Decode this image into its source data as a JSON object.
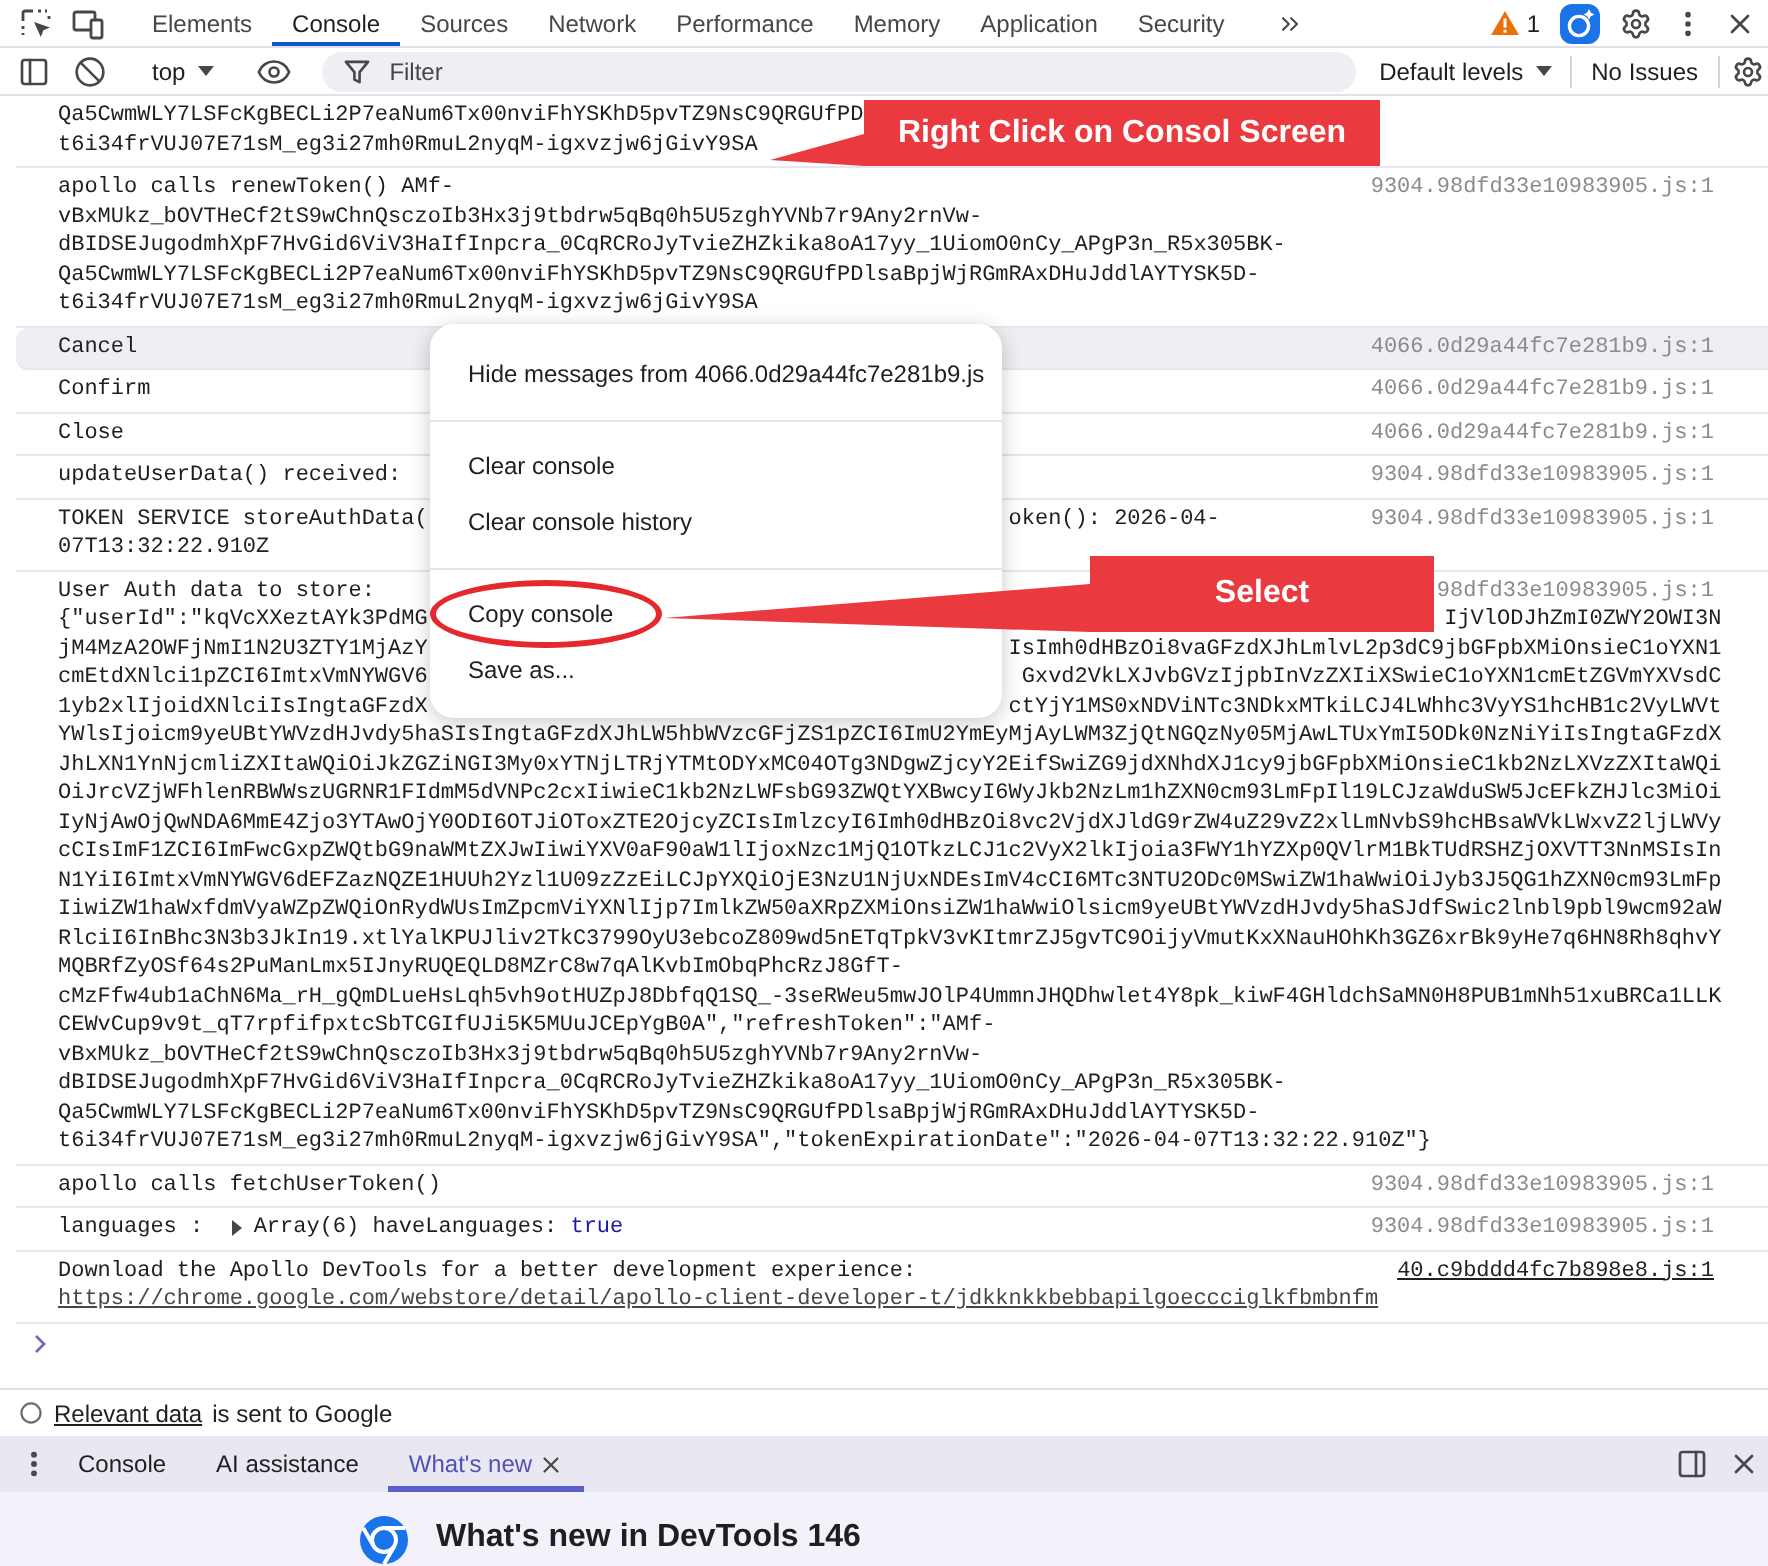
{
  "main_tabs": [
    {
      "label": "Elements",
      "selected": false
    },
    {
      "label": "Console",
      "selected": true
    },
    {
      "label": "Sources",
      "selected": false
    },
    {
      "label": "Network",
      "selected": false
    },
    {
      "label": "Performance",
      "selected": false
    },
    {
      "label": "Memory",
      "selected": false
    },
    {
      "label": "Application",
      "selected": false
    },
    {
      "label": "Security",
      "selected": false
    }
  ],
  "issues_counter": {
    "count": "1"
  },
  "toolbar": {
    "context": "top",
    "filter": {
      "placeholder": "Filter"
    },
    "levels": "Default levels",
    "issues": "No Issues"
  },
  "messages": [
    {
      "highlighted": false,
      "body": [
        {
          "kind": "split",
          "left": "Qa5CwmWLY7LSFcKgBECLi2P7eaNum6Tx00nviFhYSKhD5pvTZ9NsC9QRGUfPD"
        },
        {
          "kind": "text",
          "text": "t6i34frVUJ07E71sM_eg3i27mh0RmuL2nyqM-igxvzjw6jGivY9SA"
        }
      ]
    },
    {
      "highlighted": false,
      "lines": [
        {
          "kind": "text",
          "text": "apollo calls renewToken() AMf-"
        }
      ],
      "source": {
        "text": "9304.98dfd33e10983905.js:1",
        "dimmed": true
      },
      "body": [
        {
          "kind": "text",
          "text": "vBxMUkz_bOVTHeCf2tS9wChnQsczoIb3Hx3j9tbdrw5qBq0h5U5zghYVNb7r9Any2rnVw-"
        },
        {
          "kind": "text",
          "text": "dBIDSEJugodmhXpF7HvGid6ViV3HaIfInpcra_0CqRCRoJyTvieZHZkika8oA17yy_1UiomO0nCy_APgP3n_R5x305BK-"
        },
        {
          "kind": "text",
          "text": "Qa5CwmWLY7LSFcKgBECLi2P7eaNum6Tx00nviFhYSKhD5pvTZ9NsC9QRGUfPDlsaBpjWjRGmRAxDHuJddlAYTYSK5D-"
        },
        {
          "kind": "text",
          "text": "t6i34frVUJ07E71sM_eg3i27mh0RmuL2nyqM-igxvzjw6jGivY9SA"
        }
      ]
    },
    {
      "highlighted": true,
      "lines": [
        {
          "kind": "text",
          "text": "Cancel"
        }
      ],
      "source": {
        "text": "4066.0d29a44fc7e281b9.js:1",
        "dimmed": true
      }
    },
    {
      "highlighted": false,
      "lines": [
        {
          "kind": "text",
          "text": "Confirm"
        }
      ],
      "source": {
        "text": "4066.0d29a44fc7e281b9.js:1",
        "dimmed": true
      }
    },
    {
      "highlighted": false,
      "lines": [
        {
          "kind": "text",
          "text": "Close"
        }
      ],
      "source": {
        "text": "4066.0d29a44fc7e281b9.js:1",
        "dimmed": true
      }
    },
    {
      "highlighted": false,
      "lines": [
        {
          "kind": "text",
          "text": "updateUserData() received:"
        }
      ],
      "source": {
        "text": "9304.98dfd33e10983905.js:1",
        "dimmed": true
      }
    },
    {
      "highlighted": false,
      "lines": [
        {
          "kind": "split",
          "left": "TOKEN SERVICE storeAuthData(",
          "right": "oken(): 2026-04-"
        },
        {
          "kind": "text",
          "text": "07T13:32:22.910Z"
        }
      ],
      "source": {
        "text": "9304.98dfd33e10983905.js:1",
        "dimmed": true
      }
    },
    {
      "highlighted": false,
      "lines": [
        {
          "kind": "text",
          "text": "User Auth data to store:"
        }
      ],
      "source": {
        "text": "98dfd33e10983905.js:1",
        "dimmed": true
      },
      "body": [
        {
          "kind": "split",
          "left": "{\"userId\":\"kqVcXXeztAYk3PdMG",
          "right": "IjVlODJhZmI0ZWY2OWI3N"
        },
        {
          "kind": "split",
          "left": "jM4MzA2OWFjNmI1N2U3ZTY1MjAzY",
          "right": "IsImh0dHBzOi8vaGFzdXJhLmlvL2p3dC9jbGFpbXMiOnsieC1oYXN1"
        },
        {
          "kind": "split",
          "left": "cmEtdXNlci1pZCI6ImtxVmNYWGV6",
          "right": "Gxvd2VkLXJvbGVzIjpbInVzZXIiXSwieC1oYXN1cmEtZGVmYXVsdC"
        },
        {
          "kind": "split",
          "left": "1yb2xlIjoidXNlciIsIngtaGFzdX",
          "right": "ctYjY1MS0xNDViNTc3NDkxMTkiLCJ4LWhhc3VyYS1hcHB1c2VyLWVt"
        },
        {
          "kind": "text",
          "text": "YWlsIjoicm9yeUBtYWVzdHJvdy5haSIsIngtaGFzdXJhLW5hbWVzcGFjZS1pZCI6ImU2YmEyMjAyLWM3ZjQtNGQzNy05MjAwLTUxYmI5ODk0NzNiYiIsIngtaGFzdX"
        },
        {
          "kind": "text",
          "text": "JhLXN1YnNjcmliZXItaWQiOiJkZGZiNGI3My0xYTNjLTRjYTMtODYxMC04OTg3NDgwZjcyY2EifSwiZG9jdXNhdXJ1cy9jbGFpbXMiOnsieC1kb2NzLXVzZXItaWQi"
        },
        {
          "kind": "text",
          "text": "OiJrcVZjWFhlenRBWWszUGRNR1FIdmM5dVNPc2cxIiwieC1kb2NzLWFsbG93ZWQtYXBwcyI6WyJkb2NzLm1hZXN0cm93LmFpIl19LCJzaWduSW5JcEFkZHJlc3MiOi"
        },
        {
          "kind": "text",
          "text": "IyNjAwOjQwNDA6MmE4Zjo3YTAwOjY0ODI6OTJiOToxZTE2OjcyZCIsImlzcyI6Imh0dHBzOi8vc2VjdXJldG9rZW4uZ29vZ2xlLmNvbS9hcHBsaWVkLWxvZ2ljLWVy"
        },
        {
          "kind": "text",
          "text": "cCIsImF1ZCI6ImFwcGxpZWQtbG9naWMtZXJwIiwiYXV0aF90aW1lIjoxNzc1MjQ1OTkzLCJ1c2VyX2lkIjoia3FWY1hYZXp0QVlrM1BkTUdRSHZjOXVTT3NnMSIsIn"
        },
        {
          "kind": "text",
          "text": "N1YiI6ImtxVmNYWGV6dEFZazNQZE1HUUh2Yzl1U09zZzEiLCJpYXQiOjE3NzU1NjUxNDEsImV4cCI6MTc3NTU2ODc0MSwiZW1haWwiOiJyb3J5QG1hZXN0cm93LmFp"
        },
        {
          "kind": "text",
          "text": "IiwiZW1haWxfdmVyaWZpZWQiOnRydWUsImZpcmViYXNlIjp7ImlkZW50aXRpZXMiOnsiZW1haWwiOlsicm9yeUBtYWVzdHJvdy5haSJdfSwic2lnbl9pbl9wcm92aW"
        },
        {
          "kind": "text",
          "text": "RlciI6InBhc3N3b3JkIn19.xtlYalKPUJliv2TkC3799OyU3ebcoZ809wd5nETqTpkV3vKItmrZJ5gvTC9OijyVmutKxXNauHOhKh3GZ6xrBk9yHe7q6HN8Rh8qhvY"
        },
        {
          "kind": "text",
          "text": "MQBRfZyOSf64s2PuManLmx5IJnyRUQEQLD8MZrC8w7qAlKvbImObqPhcRzJ8GfT-"
        },
        {
          "kind": "text",
          "text": "cMzFfw4ub1aChN6Ma_rH_gQmDLueHsLqh5vh9otHUZpJ8DbfqQ1SQ_-3seRWeu5mwJOlP4UmmnJHQDhwlet4Y8pk_kiwF4GHldchSaMN0H8PUB1mNh51xuBRCa1LLK"
        },
        {
          "kind": "text",
          "text": "CEWvCup9v9t_qT7rpfifpxtcSbTCGIfUJi5K5MUuJCEpYgB0A\",\"refreshToken\":\"AMf-"
        },
        {
          "kind": "text",
          "text": "vBxMUkz_bOVTHeCf2tS9wChnQsczoIb3Hx3j9tbdrw5qBq0h5U5zghYVNb7r9Any2rnVw-"
        },
        {
          "kind": "text",
          "text": "dBIDSEJugodmhXpF7HvGid6ViV3HaIfInpcra_0CqRCRoJyTvieZHZkika8oA17yy_1UiomO0nCy_APgP3n_R5x305BK-"
        },
        {
          "kind": "text",
          "text": "Qa5CwmWLY7LSFcKgBECLi2P7eaNum6Tx00nviFhYSKhD5pvTZ9NsC9QRGUfPDlsaBpjWjRGmRAxDHuJddlAYTYSK5D-"
        },
        {
          "kind": "text",
          "text": "t6i34frVUJ07E71sM_eg3i27mh0RmuL2nyqM-igxvzjw6jGivY9SA\",\"tokenExpirationDate\":\"2026-04-07T13:32:22.910Z\"}"
        }
      ]
    },
    {
      "highlighted": false,
      "lines": [
        {
          "kind": "text",
          "text": "apollo calls fetchUserToken()"
        }
      ],
      "source": {
        "text": "9304.98dfd33e10983905.js:1",
        "dimmed": true
      }
    },
    {
      "highlighted": false,
      "lines": [
        {
          "kind": "parts",
          "parts": [
            {
              "kind": "text",
              "text": "languages :"
            },
            {
              "kind": "array",
              "text": "Array(6)",
              "expanded": false
            },
            {
              "kind": "text",
              "text": "haveLanguages:"
            },
            {
              "kind": "boolean",
              "text": "true"
            }
          ]
        }
      ],
      "source": {
        "text": "9304.98dfd33e10983905.js:1",
        "dimmed": true
      }
    },
    {
      "highlighted": false,
      "lines": [
        {
          "kind": "text",
          "text": "Download the Apollo DevTools for a better development experience:"
        }
      ],
      "source": {
        "text": "40.c9bddd4fc7b898e8.js:1",
        "dimmed": false
      },
      "body": [
        {
          "kind": "link",
          "text": "https://chrome.google.com/webstore/detail/apollo-client-developer-t/jdkknkkbebbapilgoeccciglkfbmbnfm"
        }
      ]
    }
  ],
  "notice": {
    "link": "Relevant data",
    "text": "is sent to Google"
  },
  "drawer": {
    "tabs": [
      {
        "label": "Console",
        "selected": false,
        "closable": false
      },
      {
        "label": "AI assistance",
        "selected": false,
        "closable": false
      },
      {
        "label": "What's new",
        "selected": true,
        "closable": true
      }
    ]
  },
  "whats_new": {
    "title": "What's new in DevTools 146"
  },
  "context_menu": {
    "groups": [
      {
        "items": [
          {
            "label": "Hide messages from 4066.0d29a44fc7e281b9.js",
            "circled": false
          }
        ]
      },
      {
        "items": [
          {
            "label": "Clear console",
            "circled": false
          },
          {
            "label": "Clear console history",
            "circled": false
          }
        ]
      },
      {
        "items": [
          {
            "label": "Copy console",
            "circled": true
          },
          {
            "label": "Save as...",
            "circled": false
          }
        ]
      }
    ]
  },
  "annotations": [
    {
      "text": "Right Click on Consol Screen"
    },
    {
      "text": "Select"
    }
  ]
}
